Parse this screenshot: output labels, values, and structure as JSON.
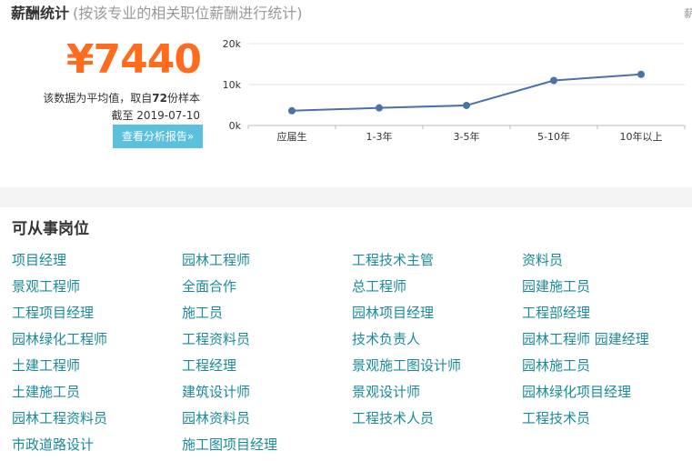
{
  "salary": {
    "title": "薪酬统计",
    "subtitle": "(按该专业的相关职位薪酬进行统计)",
    "edge_mark": "薪",
    "average_value": "¥7440",
    "note_prefix": "该数据为平均值，取自",
    "sample_count": "72",
    "note_suffix": "份样本",
    "date_line": "截至 2019-07-10",
    "report_button": "查看分析报告»",
    "line_color": "#4a72a8",
    "value_color": "#ff6b1f"
  },
  "chart_data": {
    "type": "line",
    "categories": [
      "应届生",
      "1-3年",
      "3-5年",
      "5-10年",
      "10年以上"
    ],
    "series": [
      {
        "values": [
          3600,
          4300,
          4900,
          11000,
          12500
        ]
      }
    ],
    "y_ticks": [
      "0k",
      "10k",
      "20k"
    ],
    "ylim": [
      0,
      20000
    ],
    "grid": true,
    "title": "",
    "xlabel": "",
    "ylabel": ""
  },
  "jobs": {
    "title": "可从事岗位",
    "link_color": "#1a8a9a",
    "rows": [
      [
        "项目经理",
        "园林工程师",
        "工程技术主管",
        "资料员"
      ],
      [
        "景观工程师",
        "全面合作",
        "总工程师",
        "园建施工员"
      ],
      [
        "工程项目经理",
        "施工员",
        "园林项目经理",
        "工程部经理"
      ],
      [
        "园林绿化工程师",
        "工程资料员",
        "技术负责人",
        "园林工程师 园建经理"
      ],
      [
        "土建工程师",
        "工程经理",
        "景观施工图设计师",
        "园林施工员"
      ],
      [
        "土建施工员",
        "建筑设计师",
        "景观设计师",
        "园林绿化项目经理"
      ],
      [
        "园林工程资料员",
        "园林资料员",
        "工程技术人员",
        "工程技术员"
      ],
      [
        "市政道路设计",
        "施工图项目经理"
      ]
    ]
  }
}
